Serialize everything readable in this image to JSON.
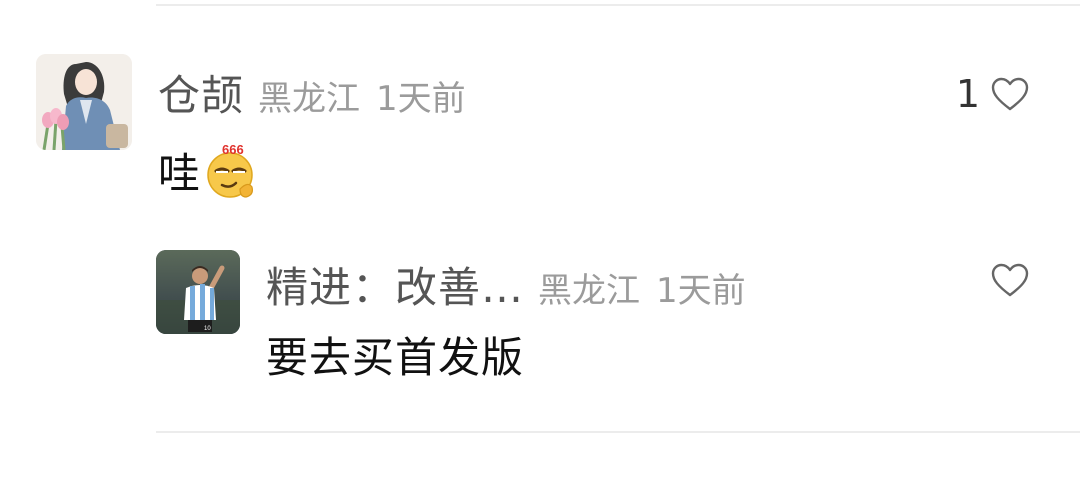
{
  "comments": [
    {
      "username": "仓颉",
      "location": "黑龙江",
      "time": "1天前",
      "text": "哇",
      "emoji_label": "666",
      "emoji_icon": "smirk-666-emoji-icon",
      "like_count": "1",
      "avatar_icon": "illustrated-girl-with-tulips-avatar"
    },
    {
      "username": "精进：改善…",
      "location": "黑龙江",
      "time": "1天前",
      "text": "要去买首发版",
      "avatar_icon": "soccer-player-avatar"
    }
  ],
  "icons": {
    "like": "heart-outline-icon"
  },
  "colors": {
    "username": "#555555",
    "meta": "#9b9b9b",
    "text": "#111111",
    "divider": "#ececec"
  }
}
